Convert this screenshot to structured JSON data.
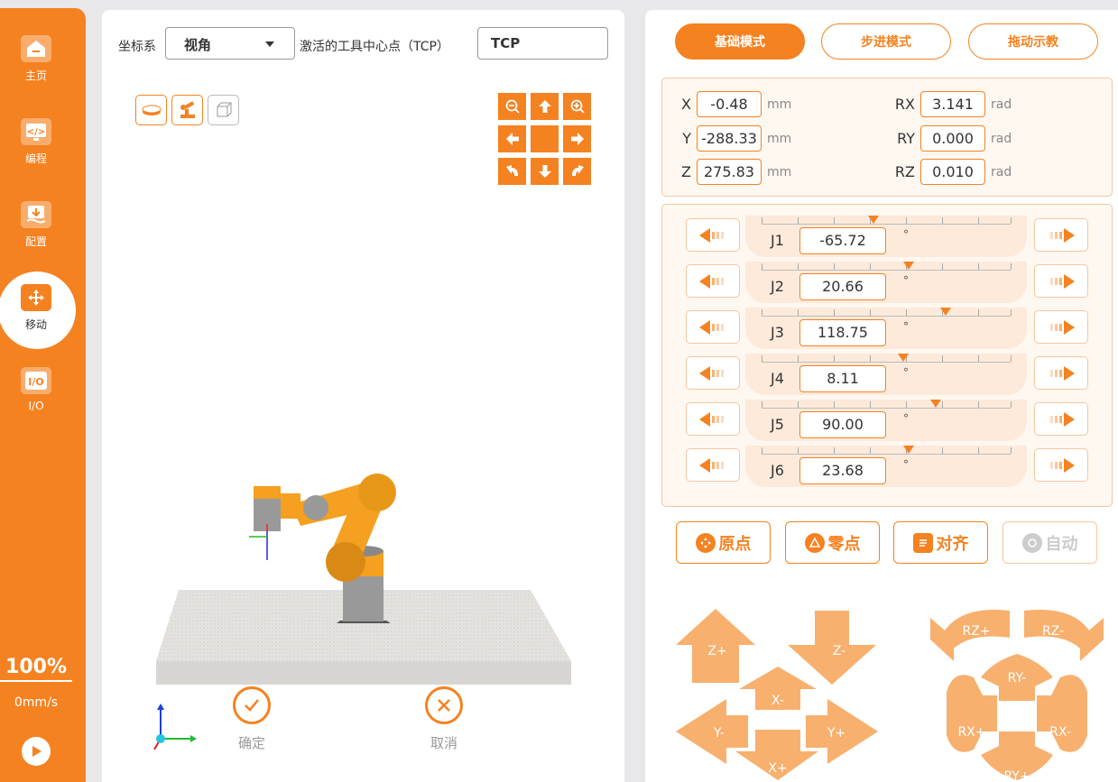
{
  "sidebar": {
    "items": [
      {
        "label": "主页",
        "icon": "home-icon"
      },
      {
        "label": "编程",
        "icon": "code-icon"
      },
      {
        "label": "配置",
        "icon": "config-icon"
      },
      {
        "label": "移动",
        "icon": "move-icon"
      },
      {
        "label": "I/O",
        "icon": "io-icon"
      }
    ],
    "active": "移动",
    "speed_percent": "100%",
    "speed_value": "0mm/s"
  },
  "viewer": {
    "coord_label": "坐标系",
    "coord_value": "视角",
    "tcp_label": "激活的工具中心点（TCP）",
    "tcp_value": "TCP",
    "confirm_label": "确定",
    "cancel_label": "取消"
  },
  "modes": {
    "basic": "基础模式",
    "step": "步进模式",
    "drag": "拖动示教",
    "active": "基础模式"
  },
  "pose": {
    "x": {
      "label": "X",
      "value": "-0.48",
      "unit": "mm"
    },
    "y": {
      "label": "Y",
      "value": "-288.33",
      "unit": "mm"
    },
    "z": {
      "label": "Z",
      "value": "275.83",
      "unit": "mm"
    },
    "rx": {
      "label": "RX",
      "value": "3.141",
      "unit": "rad"
    },
    "ry": {
      "label": "RY",
      "value": "0.000",
      "unit": "rad"
    },
    "rz": {
      "label": "RZ",
      "value": "0.010",
      "unit": "rad"
    }
  },
  "joints": [
    {
      "label": "J1",
      "value": "-65.72",
      "unit": "°",
      "level": 0.45
    },
    {
      "label": "J2",
      "value": "20.66",
      "unit": "°",
      "level": 0.59
    },
    {
      "label": "J3",
      "value": "118.75",
      "unit": "°",
      "level": 0.74
    },
    {
      "label": "J4",
      "value": "8.11",
      "unit": "°",
      "level": 0.57
    },
    {
      "label": "J5",
      "value": "90.00",
      "unit": "°",
      "level": 0.7
    },
    {
      "label": "J6",
      "value": "23.68",
      "unit": "°",
      "level": 0.59
    }
  ],
  "functions": {
    "home": "原点",
    "zero": "零点",
    "align": "对齐",
    "auto": "自动"
  },
  "jog_linear": {
    "z_plus": "Z+",
    "z_minus": "Z-",
    "x_minus": "X-",
    "x_plus": "X+",
    "y_minus": "Y-",
    "y_plus": "Y+"
  },
  "jog_rotary": {
    "rz_plus": "RZ+",
    "rz_minus": "RZ-",
    "ry_minus": "RY-",
    "ry_plus": "RY+",
    "rx_plus": "RX+",
    "rx_minus": "RX-"
  },
  "colors": {
    "accent": "#f58220",
    "accent_light": "#f8c79c",
    "panel_bg": "#fff8f1"
  }
}
